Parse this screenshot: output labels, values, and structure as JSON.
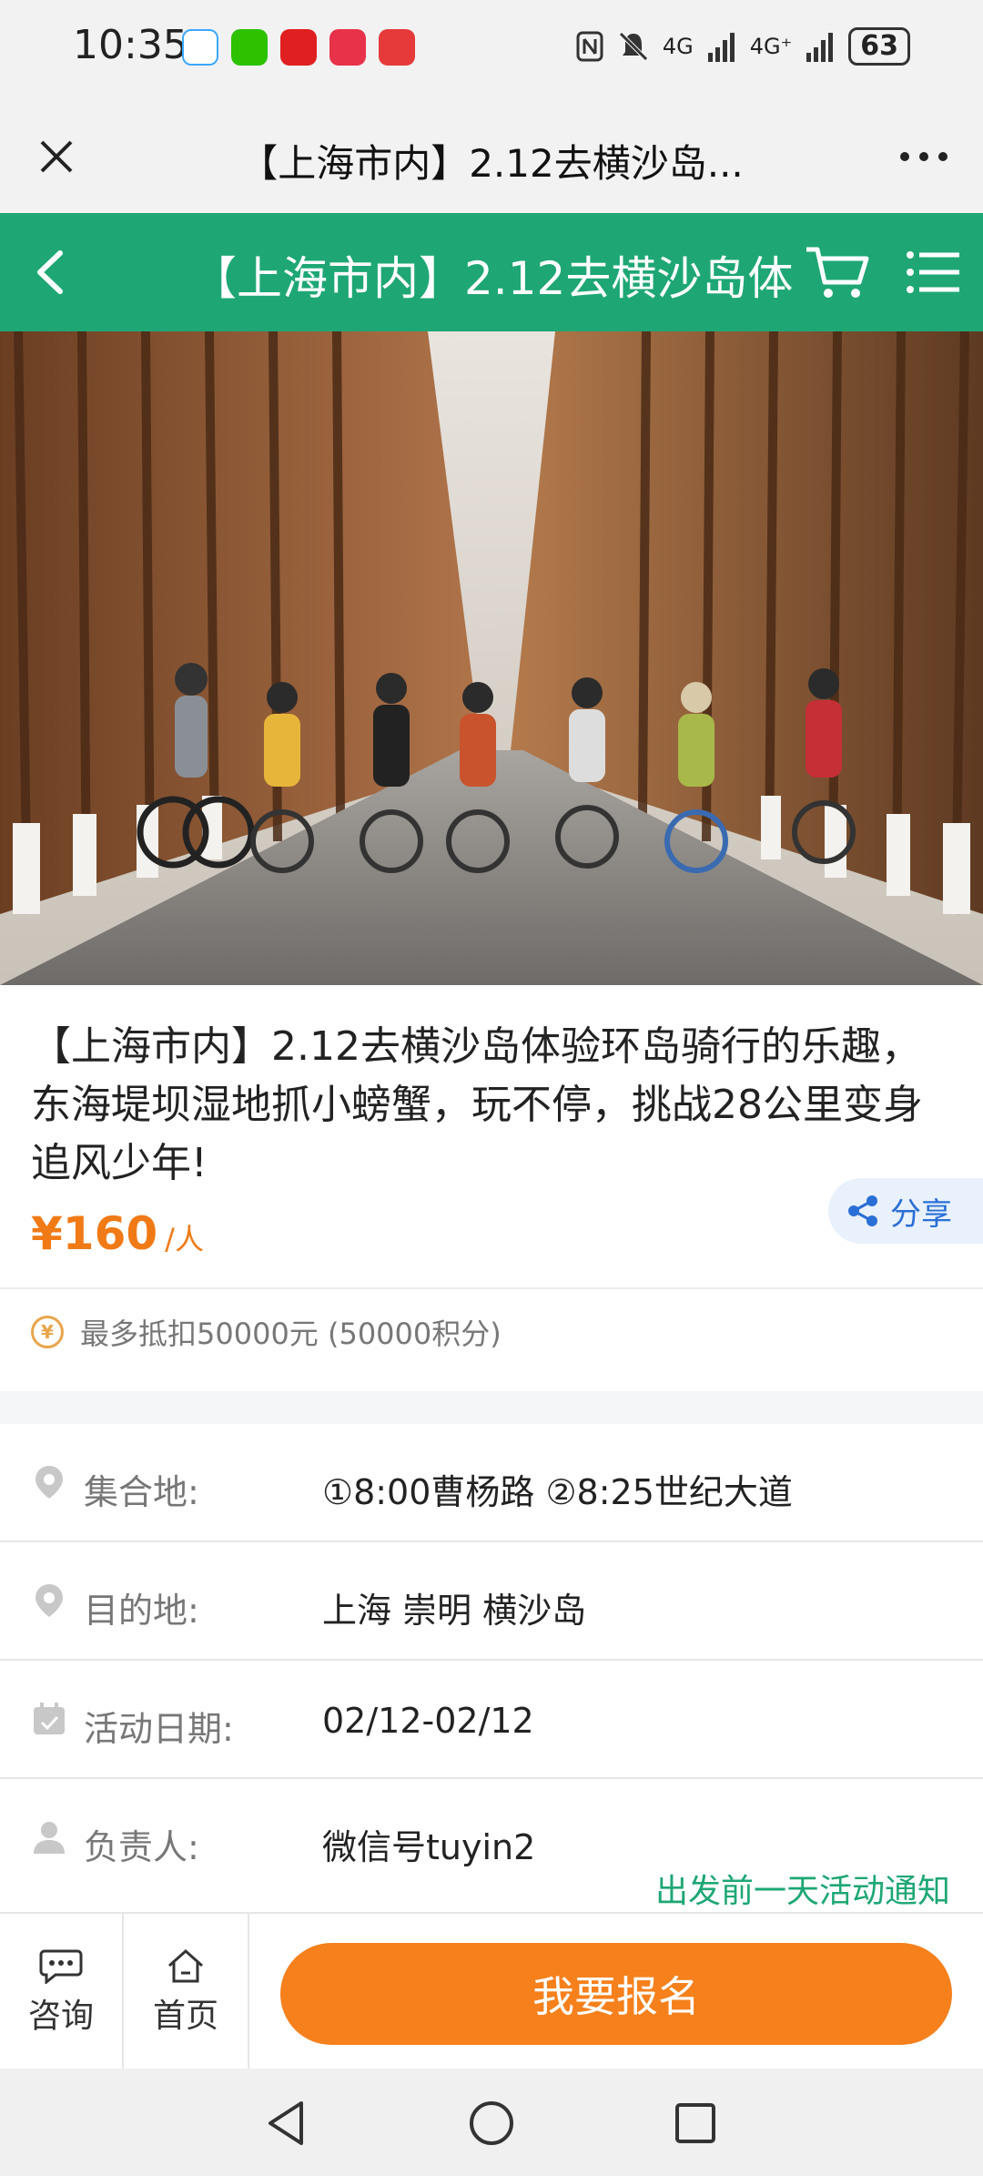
{
  "status_bar": {
    "time": "10:35",
    "network_1": "4G",
    "network_2": "4G⁺",
    "battery": "63"
  },
  "webview": {
    "title": "【上海市内】2.12去横沙岛..."
  },
  "app_bar": {
    "title": "【上海市内】2.12去横沙岛体",
    "accent_color": "#1ea774"
  },
  "product": {
    "title": "【上海市内】2.12去横沙岛体验环岛骑行的乐趣，东海堤坝湿地抓小螃蟹，玩不停，挑战28公里变身追风少年!",
    "price": "¥160",
    "price_unit": "/人",
    "share_label": "分享",
    "points_text": "最多抵扣50000元 (50000积分)",
    "points_icon_glyph": "¥",
    "price_color": "#f07a16"
  },
  "info": {
    "meeting": {
      "label": "集合地:",
      "value": "①8:00曹杨路 ②8:25世纪大道",
      "icon": "location-pin-icon"
    },
    "destination": {
      "label": "目的地:",
      "value": "上海 崇明 横沙岛",
      "icon": "location-pin-icon"
    },
    "date": {
      "label": "活动日期:",
      "value": "02/12-02/12",
      "icon": "calendar-icon"
    },
    "leader": {
      "label": "负责人:",
      "value": "微信号tuyin2",
      "icon": "person-icon"
    },
    "notice": "出发前一天活动通知"
  },
  "action_bar": {
    "consult_label": "咨询",
    "home_label": "首页",
    "signup_label": "我要报名",
    "signup_color": "#f5801c"
  }
}
